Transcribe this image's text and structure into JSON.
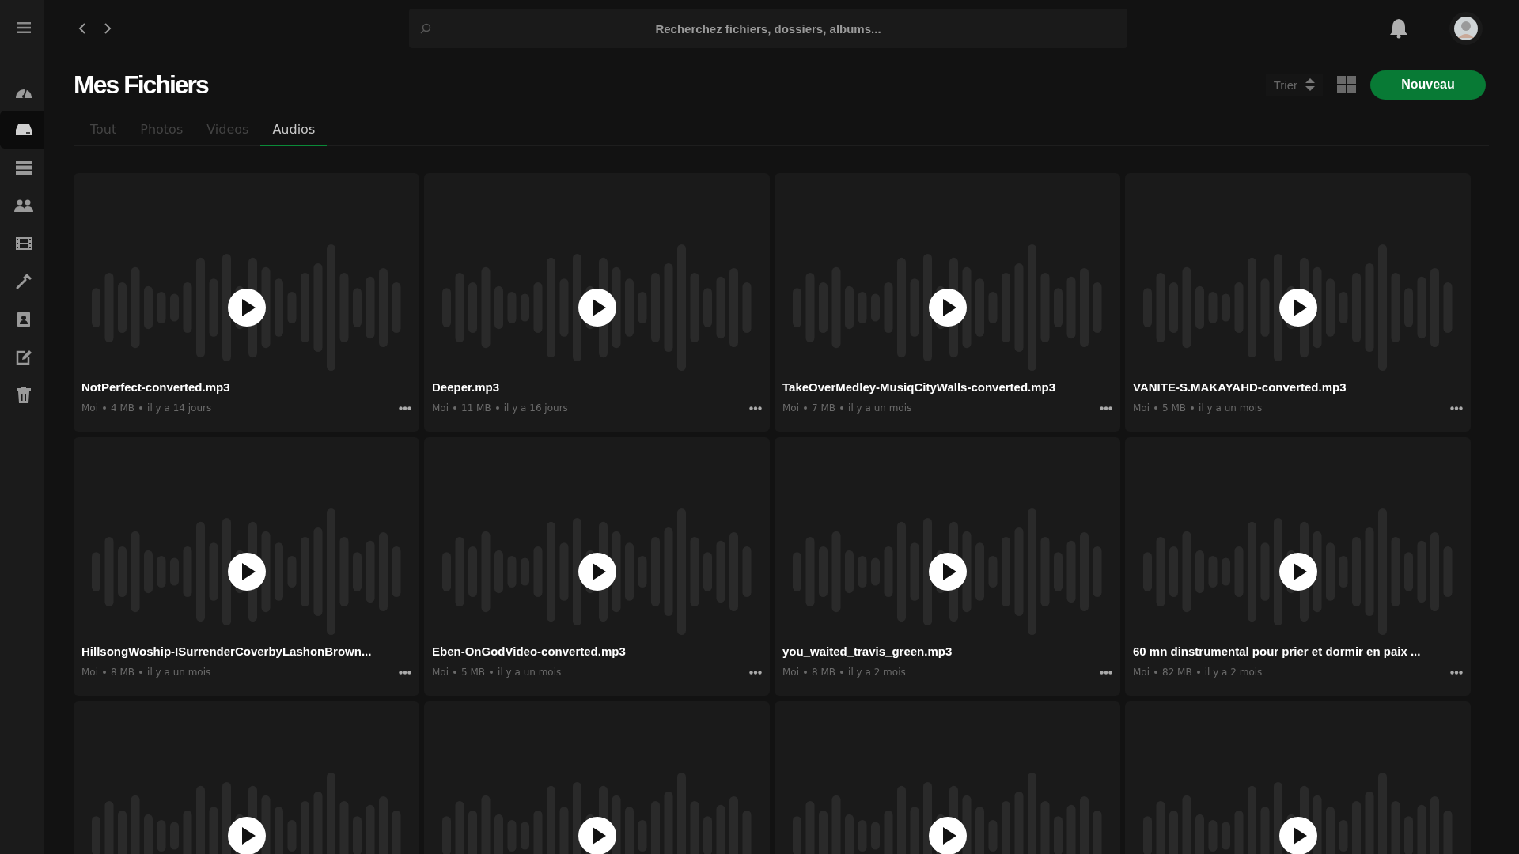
{
  "topbar": {
    "search": {
      "placeholder": "Recherchez fichiers, dossiers, albums..."
    }
  },
  "sidebar": {
    "items": [
      {
        "kind": "dashboard",
        "selected": false
      },
      {
        "kind": "drive",
        "selected": true
      },
      {
        "kind": "storage",
        "selected": false
      },
      {
        "kind": "users",
        "selected": false
      },
      {
        "kind": "film",
        "selected": false
      },
      {
        "kind": "hammer",
        "selected": false
      },
      {
        "kind": "contact",
        "selected": false
      },
      {
        "kind": "edit",
        "selected": false
      },
      {
        "kind": "trash",
        "selected": false
      }
    ]
  },
  "page": {
    "title": "Mes Fichiers",
    "sort_label": "Trier",
    "new_button": "Nouveau"
  },
  "tabs": [
    {
      "label": "Tout",
      "selected": false
    },
    {
      "label": "Photos",
      "selected": false
    },
    {
      "label": "Videos",
      "selected": false
    },
    {
      "label": "Audios",
      "selected": true
    }
  ],
  "files": [
    {
      "name": "NotPerfect-converted.mp3",
      "owner": "Moi",
      "size": "4 MB",
      "date": "il y a 14 jours"
    },
    {
      "name": "Deeper.mp3",
      "owner": "Moi",
      "size": "11 MB",
      "date": "il y a 16 jours"
    },
    {
      "name": "TakeOverMedley-MusiqCityWalls-converted.mp3",
      "owner": "Moi",
      "size": "7 MB",
      "date": "il y a un mois"
    },
    {
      "name": "VANITE-S.MAKAYAHD-converted.mp3",
      "owner": "Moi",
      "size": "5 MB",
      "date": "il y a un mois"
    },
    {
      "name": "HillsongWoship-ISurrenderCoverbyLashonBrown...",
      "owner": "Moi",
      "size": "8 MB",
      "date": "il y a un mois"
    },
    {
      "name": "Eben-OnGodVideo-converted.mp3",
      "owner": "Moi",
      "size": "5 MB",
      "date": "il y a un mois"
    },
    {
      "name": "you_waited_travis_green.mp3",
      "owner": "Moi",
      "size": "8 MB",
      "date": "il y a 2 mois"
    },
    {
      "name": "60 mn dinstrumental pour prier et dormir en paix ...",
      "owner": "Moi",
      "size": "82 MB",
      "date": "il y a 2 mois"
    }
  ],
  "partial_files": [
    {
      "kind": "audio"
    },
    {
      "kind": "audio"
    },
    {
      "kind": "audio"
    },
    {
      "kind": "audio"
    }
  ]
}
